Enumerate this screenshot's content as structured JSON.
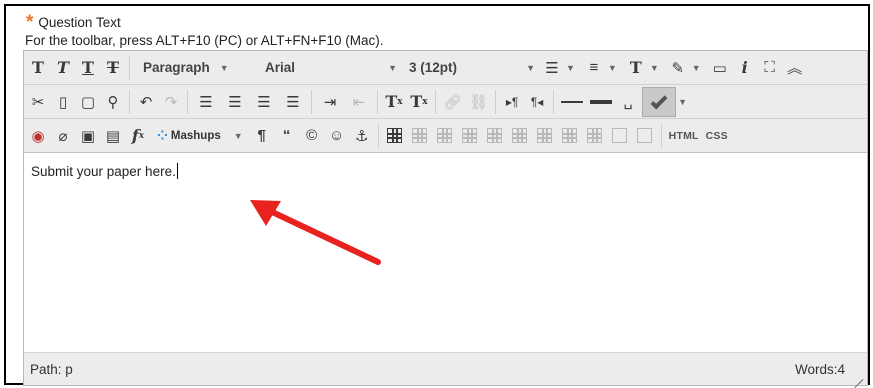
{
  "question": {
    "required_marker": "*",
    "label": "Question Text",
    "hint": "For the toolbar, press ALT+F10 (PC) or ALT+FN+F10 (Mac)."
  },
  "toolbar": {
    "row1": {
      "bold": "T",
      "italic": "T",
      "underline": "T",
      "strikethrough": "T",
      "paragraph_select": "Paragraph",
      "font_select": "Arial",
      "size_select": "3 (12pt)",
      "info": "i"
    },
    "row2": {
      "superscript": "T",
      "superscript_mark": "x",
      "subscript": "T",
      "subscript_mark": "x"
    },
    "row3": {
      "formula": "f",
      "formula_mark": "x",
      "mashups": "Mashups",
      "html": "HTML",
      "css": "CSS",
      "quote": "“",
      "copyright": "©"
    }
  },
  "editor": {
    "content": "Submit your paper here."
  },
  "statusbar": {
    "path_label": "Path:",
    "path_value": "p",
    "words_label": "Words:",
    "words_value": "4"
  },
  "colors": {
    "required": "#e8742a",
    "arrow": "#e8221f",
    "toolbar_bg": "#ececec",
    "mashups_icon": "#2e8ad8"
  }
}
